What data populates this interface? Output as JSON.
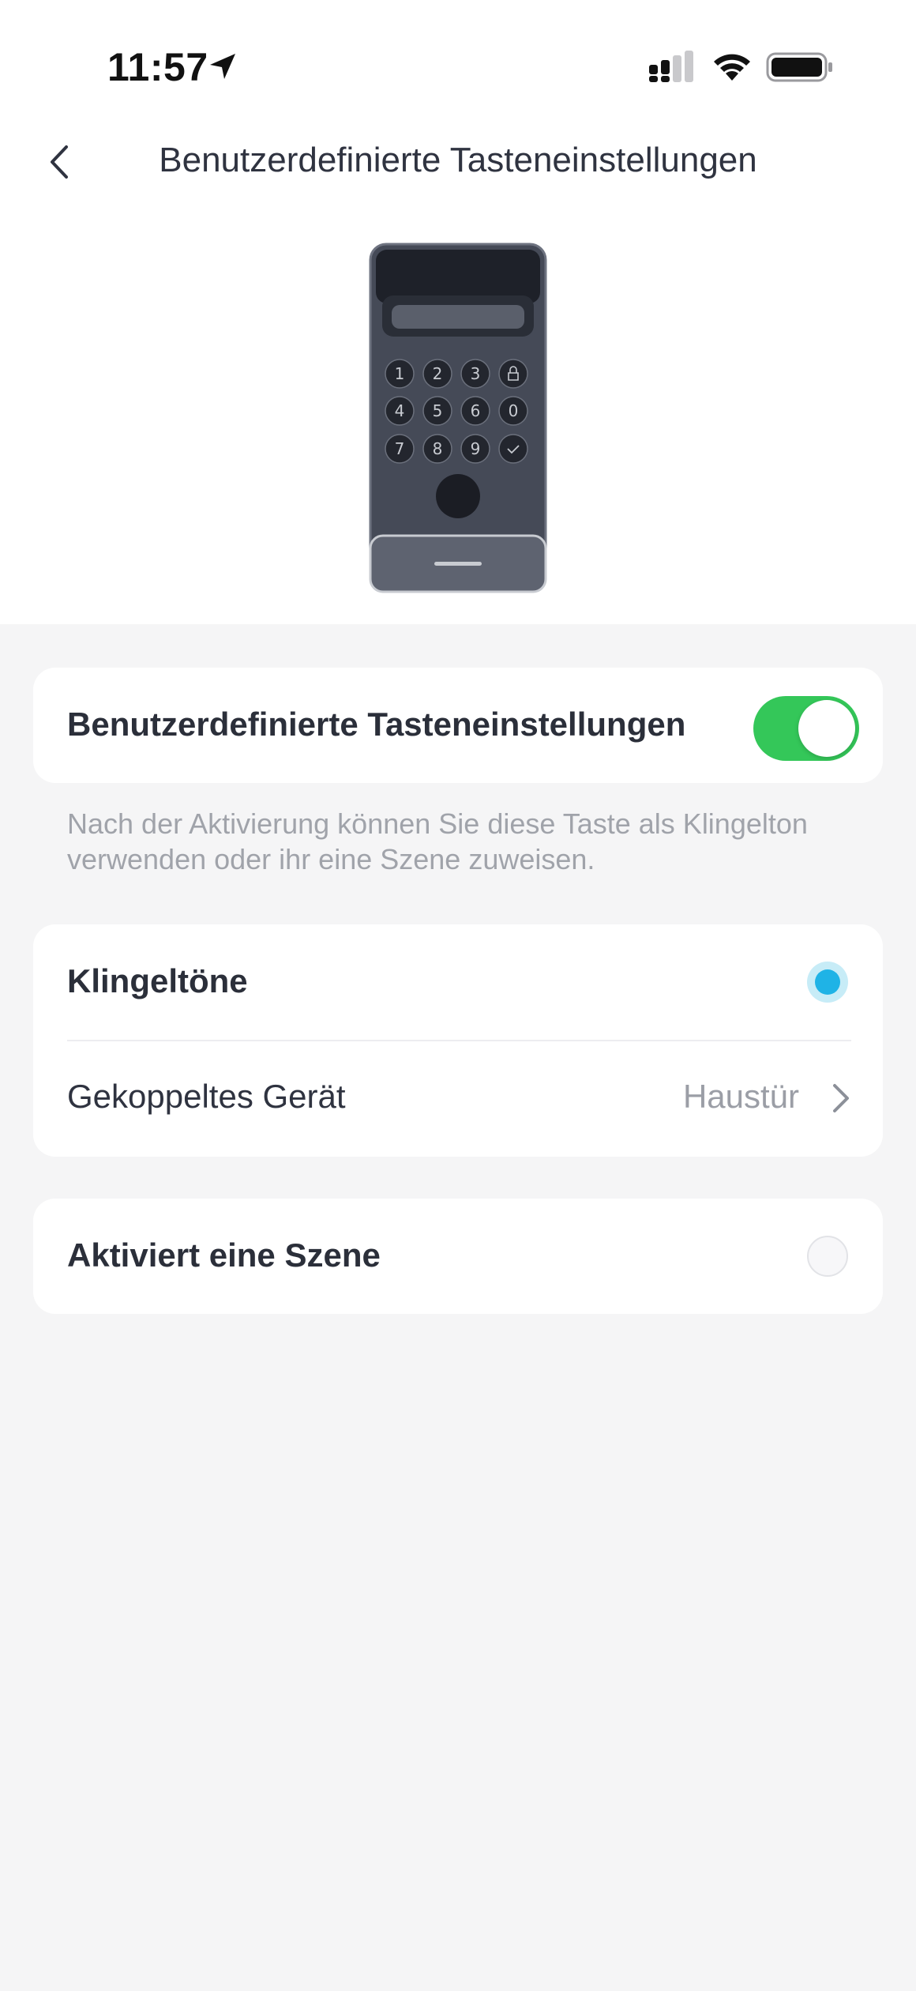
{
  "status_bar": {
    "time": "11:57"
  },
  "header": {
    "title": "Benutzerdefinierte Tasteneinstellungen"
  },
  "device": {
    "keys": [
      "1",
      "2",
      "3",
      "4",
      "5",
      "6",
      "0",
      "7",
      "8",
      "9"
    ]
  },
  "toggle_card": {
    "label": "Benutzerdefinierte Tasteneinstellungen",
    "enabled": true
  },
  "helper_text": "Nach der Aktivierung können Sie diese Taste als Klingelton verwenden oder ihr eine Szene zuweisen.",
  "options": {
    "ringtones": {
      "label": "Klingeltöne",
      "selected": true
    },
    "paired_device": {
      "label": "Gekoppeltes Gerät",
      "value": "Haustür"
    },
    "scene": {
      "label": "Aktiviert eine Szene",
      "selected": false
    }
  },
  "colors": {
    "toggle_on": "#34c759",
    "radio_accent": "#1fb3e6"
  }
}
